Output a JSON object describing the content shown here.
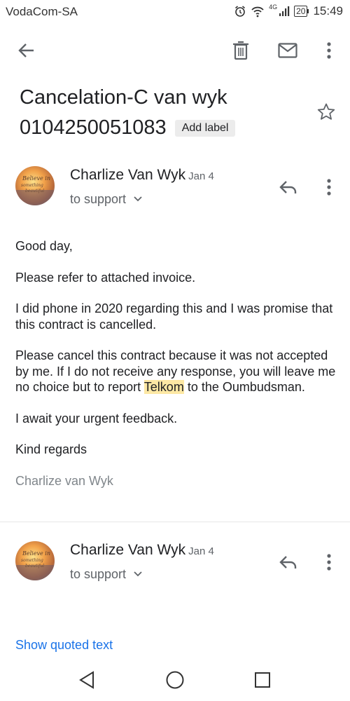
{
  "status_bar": {
    "carrier": "VodaCom-SA",
    "network": "4G",
    "battery": "20",
    "time": "15:49",
    "icons": [
      "alarm-icon",
      "wifi-icon",
      "signal-icon",
      "battery-icon"
    ]
  },
  "toolbar": {
    "icons": [
      "back-arrow-icon",
      "delete-icon",
      "mail-icon",
      "more-vert-icon"
    ]
  },
  "email": {
    "subject": "Cancelation-C van wyk 0104250051083",
    "add_label": "Add label"
  },
  "messages": [
    {
      "sender": "Charlize Van Wyk",
      "date": "Jan 4",
      "to": "to support",
      "avatar_text": "Believe in something beautiful",
      "body": {
        "greeting": "Good day,",
        "p1": "Please refer to attached invoice.",
        "p2": "I did phone in 2020 regarding this and I was promise that this contract is cancelled.",
        "p3_before": "Please cancel this contract because it was not accepted by me.  If I do not receive any response, you will leave me no choice but to report ",
        "p3_highlight": "Telkom",
        "p3_after": " to the Oumbudsman.",
        "p4": "I await your urgent feedback.",
        "closing": "Kind regards",
        "signature": "Charlize van Wyk"
      }
    },
    {
      "sender": "Charlize Van Wyk",
      "date": "Jan 4",
      "to": "to support",
      "avatar_text": "Believe in something beautiful",
      "show_quoted": "Show quoted text"
    }
  ],
  "colors": {
    "link": "#1a73e8",
    "highlight": "#fde8a4",
    "secondary_text": "#5f6368"
  }
}
